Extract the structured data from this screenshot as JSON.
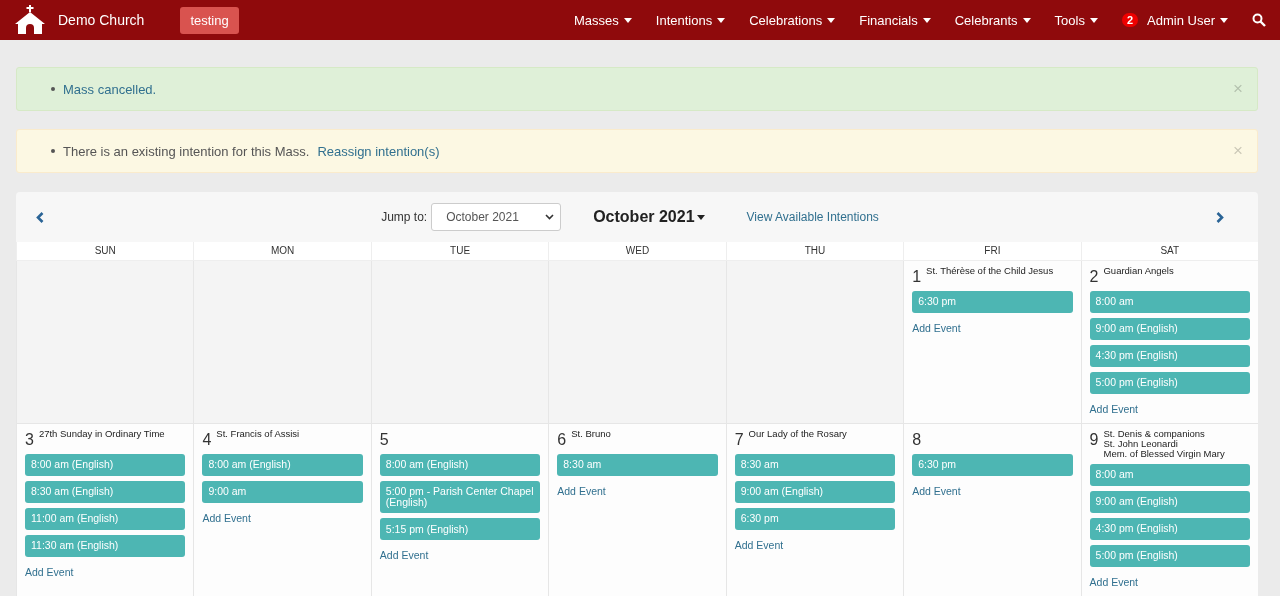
{
  "navbar": {
    "brand": "Demo Church",
    "env_badge": "testing",
    "menus": [
      {
        "label": "Masses"
      },
      {
        "label": "Intentions"
      },
      {
        "label": "Celebrations"
      },
      {
        "label": "Financials"
      },
      {
        "label": "Celebrants"
      },
      {
        "label": "Tools"
      }
    ],
    "user": {
      "badge": "2",
      "label": "Admin User"
    }
  },
  "alerts": [
    {
      "kind": "success",
      "text": "Mass cancelled.",
      "close": "×"
    },
    {
      "kind": "warning",
      "text": "There is an existing intention for this Mass.",
      "link": "Reassign intention(s)",
      "close": "×"
    }
  ],
  "calendar": {
    "jump_label": "Jump to:",
    "jump_value": "October 2021",
    "month": "October 2021",
    "intentions_link": "View Available Intentions",
    "weekdays": [
      "SUN",
      "MON",
      "TUE",
      "WED",
      "THU",
      "FRI",
      "SAT"
    ],
    "weeks": [
      {
        "days": [
          {
            "kind": "empty"
          },
          {
            "kind": "empty"
          },
          {
            "kind": "empty"
          },
          {
            "kind": "empty"
          },
          {
            "kind": "empty"
          },
          {
            "kind": "day",
            "number": "1",
            "feasts": [
              "St. Thérèse of the Child Jesus"
            ],
            "events": [
              "6:30 pm"
            ],
            "add": "Add Event"
          },
          {
            "kind": "day",
            "number": "2",
            "feasts": [
              "Guardian Angels"
            ],
            "events": [
              "8:00 am",
              "9:00 am (English)",
              "4:30 pm (English)",
              "5:00 pm (English)"
            ],
            "add": "Add Event"
          }
        ]
      },
      {
        "days": [
          {
            "kind": "day",
            "number": "3",
            "feasts": [
              "27th Sunday in Ordinary Time"
            ],
            "events": [
              "8:00 am (English)",
              "8:30 am (English)",
              "11:00 am (English)",
              "11:30 am (English)"
            ],
            "add": "Add Event"
          },
          {
            "kind": "day",
            "number": "4",
            "feasts": [
              "St. Francis of Assisi"
            ],
            "events": [
              "8:00 am (English)",
              "9:00 am"
            ],
            "add": "Add Event"
          },
          {
            "kind": "day",
            "number": "5",
            "events": [
              "8:00 am (English)",
              "5:00 pm - Parish Center Chapel (English)",
              "5:15 pm (English)"
            ],
            "add": "Add Event"
          },
          {
            "kind": "day",
            "number": "6",
            "feasts": [
              "St. Bruno"
            ],
            "events": [
              "8:30 am"
            ],
            "add": "Add Event"
          },
          {
            "kind": "day",
            "number": "7",
            "feasts": [
              "Our Lady of the Rosary"
            ],
            "events": [
              "8:30 am",
              "9:00 am (English)",
              "6:30 pm"
            ],
            "add": "Add Event"
          },
          {
            "kind": "day",
            "number": "8",
            "events": [
              "6:30 pm"
            ],
            "add": "Add Event"
          },
          {
            "kind": "day",
            "number": "9",
            "feasts": [
              "St. Denis & companions",
              "St. John Leonardi",
              "Mem. of Blessed Virgin Mary"
            ],
            "events": [
              "8:00 am",
              "9:00 am (English)",
              "4:30 pm (English)",
              "5:00 pm (English)"
            ],
            "add": "Add Event"
          }
        ]
      }
    ]
  }
}
